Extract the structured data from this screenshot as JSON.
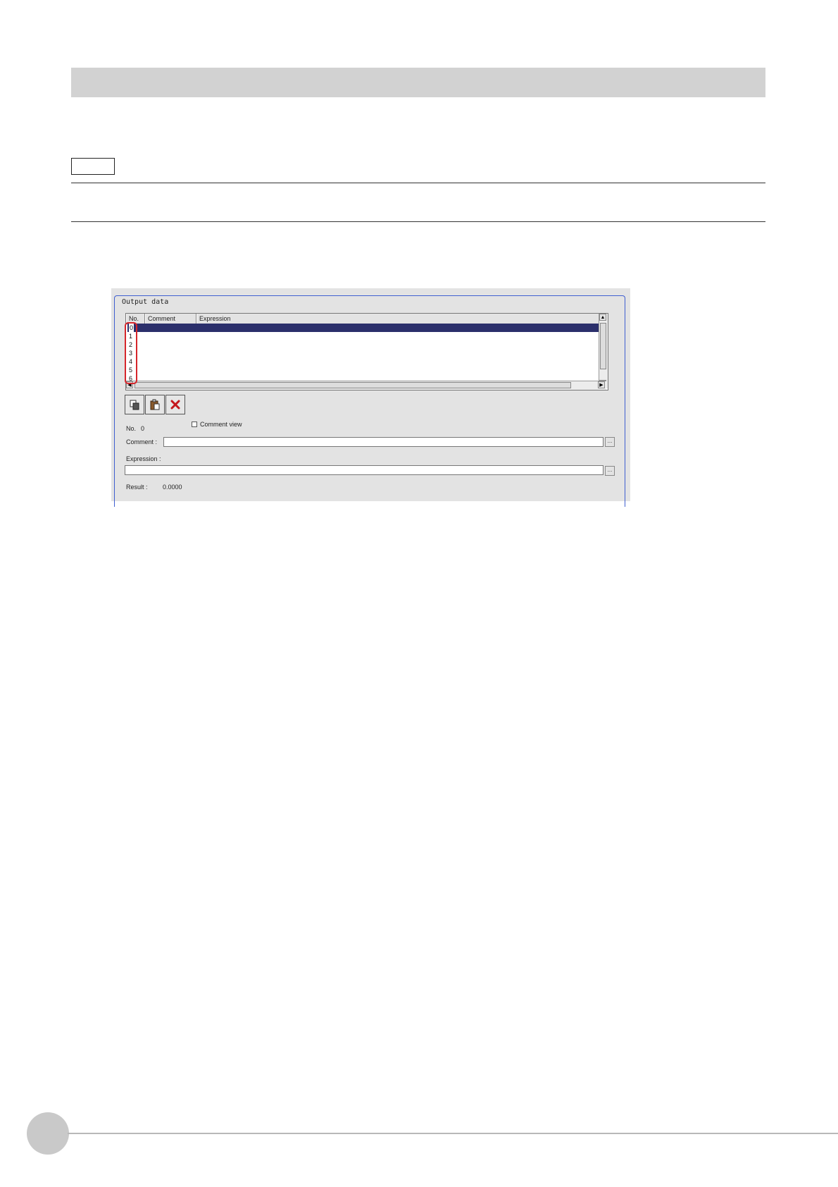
{
  "group_title": "Output data",
  "grid": {
    "columns": [
      "No.",
      "Comment",
      "Expression"
    ],
    "rows": [
      "0",
      "1",
      "2",
      "3",
      "4",
      "5",
      "6"
    ],
    "selected_row": "0"
  },
  "toolbar": {
    "copy_icon": "copy-icon",
    "paste_icon": "paste-icon",
    "delete_icon": "delete-x-icon"
  },
  "form": {
    "no_label": "No.",
    "no_value": "0",
    "comment_view_label": "Comment view",
    "comment_label": "Comment :",
    "comment_value": "",
    "expression_label": "Expression :",
    "expression_value": "",
    "browse_label": "...",
    "result_label": "Result :",
    "result_value": "0.0000"
  },
  "colors": {
    "selection": "#2b2f6b",
    "highlight": "#d6262b",
    "group_border": "#3f5fd0"
  }
}
